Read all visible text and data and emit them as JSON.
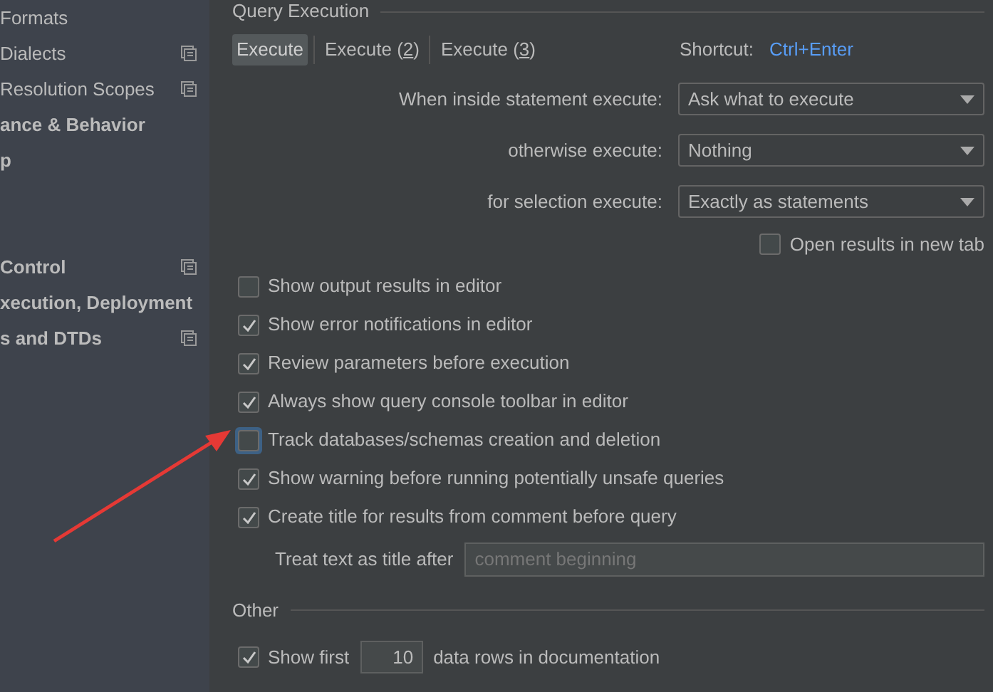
{
  "sidebar": {
    "groups": [
      [
        {
          "label": "Formats",
          "bold": false,
          "has_icon": false
        },
        {
          "label": "Dialects",
          "bold": false,
          "has_icon": true
        },
        {
          "label": "Resolution Scopes",
          "bold": false,
          "has_icon": true
        },
        {
          "label": "ance & Behavior",
          "bold": true,
          "has_icon": false
        },
        {
          "label": "p",
          "bold": true,
          "has_icon": false
        }
      ],
      [
        {
          "label": "Control",
          "bold": true,
          "has_icon": true
        },
        {
          "label": "xecution, Deployment",
          "bold": true,
          "has_icon": false
        },
        {
          "label": "s and DTDs",
          "bold": true,
          "has_icon": true
        }
      ]
    ]
  },
  "query_execution": {
    "title": "Query Execution",
    "tabs": [
      {
        "label": "Execute",
        "selected": true
      },
      {
        "label": "Execute (",
        "mnemonic": "2",
        "selected": false
      },
      {
        "label": "Execute (",
        "mnemonic": "3",
        "selected": false
      }
    ],
    "tab_suffix": ")",
    "shortcut_label": "Shortcut:",
    "shortcut": "Ctrl+Enter",
    "dropdowns": [
      {
        "label": "When inside statement execute:",
        "value": "Ask what to execute"
      },
      {
        "label": "otherwise execute:",
        "value": "Nothing"
      },
      {
        "label": "for selection execute:",
        "value": "Exactly as statements"
      }
    ],
    "open_in_new_tab": {
      "label": "Open results in new tab",
      "checked": false
    },
    "checkboxes": [
      {
        "label": "Show output results in editor",
        "checked": false,
        "focused": false
      },
      {
        "label": "Show error notifications in editor",
        "checked": true,
        "focused": false
      },
      {
        "label": "Review parameters before execution",
        "checked": true,
        "focused": false
      },
      {
        "label": "Always show query console toolbar in editor",
        "checked": true,
        "focused": false
      },
      {
        "label": "Track databases/schemas creation and deletion",
        "checked": false,
        "focused": true
      },
      {
        "label": "Show warning before running potentially unsafe queries",
        "checked": true,
        "focused": false
      },
      {
        "label": "Create title for results from comment before query",
        "checked": true,
        "focused": false
      }
    ],
    "title_field": {
      "label": "Treat text as title after",
      "placeholder": "comment beginning"
    }
  },
  "other": {
    "title": "Other",
    "show_first": {
      "checked": true,
      "label": "Show first",
      "value": "10",
      "suffix": "data rows in documentation"
    }
  }
}
